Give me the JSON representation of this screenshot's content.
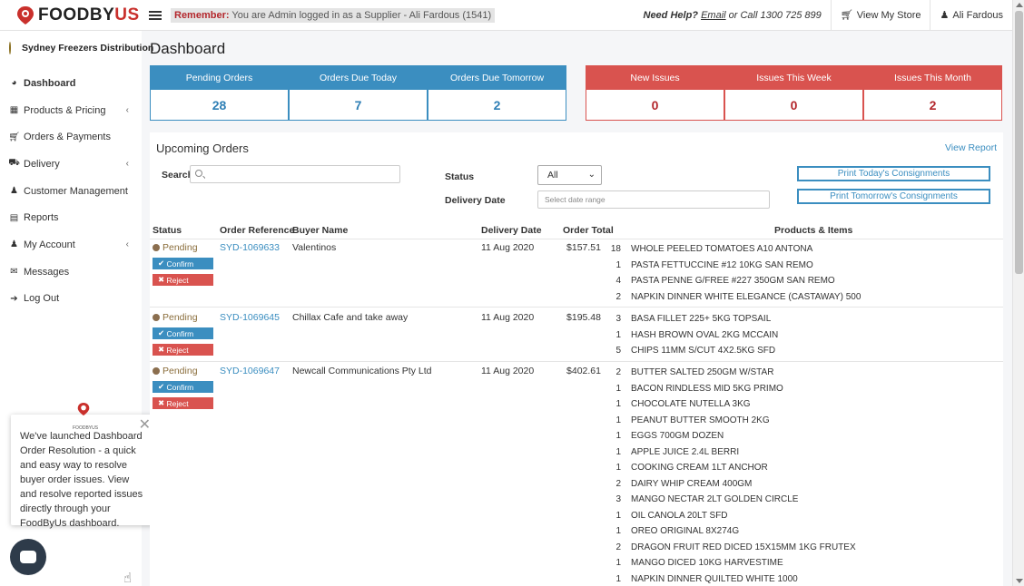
{
  "brand": {
    "name_main": "FOODBY",
    "name_accent": "US",
    "small": "FOODBYUS"
  },
  "header": {
    "remember_label": "Remember:",
    "remember_text": "You are Admin logged in as a Supplier - Ali Fardous (1541)",
    "help_prefix": "Need Help?",
    "help_email": "Email",
    "help_suffix": "or Call 1300 725 899",
    "view_store": "View My Store",
    "user": "Ali Fardous"
  },
  "sidebar": {
    "store_name": "Sydney Freezers Distribution",
    "items": [
      {
        "label": "Dashboard",
        "icon": "dashboard-icon"
      },
      {
        "label": "Products & Pricing",
        "icon": "gift-icon"
      },
      {
        "label": "Orders & Payments",
        "icon": "cart-icon"
      },
      {
        "label": "Delivery",
        "icon": "truck-icon"
      },
      {
        "label": "Customer Management",
        "icon": "users-icon"
      },
      {
        "label": "Reports",
        "icon": "bar-chart-icon"
      },
      {
        "label": "My Account",
        "icon": "user-icon"
      },
      {
        "label": "Messages",
        "icon": "envelope-icon"
      },
      {
        "label": "Log Out",
        "icon": "sign-out-icon"
      }
    ]
  },
  "promo": {
    "text": "We've launched Dashboard Order Resolution - a quick and easy way to resolve buyer order issues. View and resolve reported issues directly through your FoodByUs dashboard."
  },
  "page": {
    "title": "Dashboard"
  },
  "stats_blue": [
    {
      "label": "Pending Orders",
      "value": "28"
    },
    {
      "label": "Orders Due Today",
      "value": "7"
    },
    {
      "label": "Orders Due Tomorrow",
      "value": "2"
    }
  ],
  "stats_red": [
    {
      "label": "New Issues",
      "value": "0"
    },
    {
      "label": "Issues This Week",
      "value": "0"
    },
    {
      "label": "Issues This Month",
      "value": "2"
    }
  ],
  "upcoming": {
    "title": "Upcoming Orders",
    "view_report": "View Report",
    "search_label": "Search",
    "status_label": "Status",
    "status_value": "All",
    "delivery_date_label": "Delivery Date",
    "date_placeholder": "Select date range",
    "print_today": "Print Today's Consignments",
    "print_tomorrow": "Print Tomorrow's Consignments",
    "columns": [
      "Status",
      "Order Reference",
      "Buyer Name",
      "Delivery Date",
      "Order Total",
      "Products & Items"
    ],
    "confirm_label": "Confirm",
    "reject_label": "Reject",
    "orders": [
      {
        "status": "Pending",
        "ref": "SYD-1069633",
        "buyer": "Valentinos",
        "date": "11 Aug 2020",
        "total": "$157.51",
        "items": [
          {
            "qty": "18",
            "name": "WHOLE PEELED TOMATOES A10 ANTONA"
          },
          {
            "qty": "1",
            "name": "PASTA FETTUCCINE #12 10KG SAN REMO"
          },
          {
            "qty": "4",
            "name": "PASTA PENNE G/FREE #227 350GM SAN REMO"
          },
          {
            "qty": "2",
            "name": "NAPKIN DINNER WHITE ELEGANCE (CASTAWAY) 500"
          }
        ]
      },
      {
        "status": "Pending",
        "ref": "SYD-1069645",
        "buyer": "Chillax Cafe and take away",
        "date": "11 Aug 2020",
        "total": "$195.48",
        "items": [
          {
            "qty": "3",
            "name": "BASA FILLET 225+ 5KG TOPSAIL"
          },
          {
            "qty": "1",
            "name": "HASH BROWN OVAL 2KG MCCAIN"
          },
          {
            "qty": "5",
            "name": "CHIPS 11MM S/CUT 4X2.5KG SFD"
          }
        ]
      },
      {
        "status": "Pending",
        "ref": "SYD-1069647",
        "buyer": "Newcall Communications Pty Ltd",
        "date": "11 Aug 2020",
        "total": "$402.61",
        "items": [
          {
            "qty": "2",
            "name": "BUTTER SALTED 250GM W/STAR"
          },
          {
            "qty": "1",
            "name": "BACON RINDLESS MID 5KG PRIMO"
          },
          {
            "qty": "1",
            "name": "CHOCOLATE NUTELLA 3KG"
          },
          {
            "qty": "1",
            "name": "PEANUT BUTTER SMOOTH 2KG"
          },
          {
            "qty": "1",
            "name": "EGGS 700GM DOZEN"
          },
          {
            "qty": "1",
            "name": "APPLE JUICE 2.4L BERRI"
          },
          {
            "qty": "1",
            "name": "COOKING CREAM 1LT ANCHOR"
          },
          {
            "qty": "2",
            "name": "DAIRY WHIP CREAM 400GM"
          },
          {
            "qty": "3",
            "name": "MANGO NECTAR 2LT GOLDEN CIRCLE"
          },
          {
            "qty": "1",
            "name": "OIL CANOLA 20LT SFD"
          },
          {
            "qty": "1",
            "name": "OREO ORIGINAL 8X274G"
          },
          {
            "qty": "2",
            "name": "DRAGON FRUIT RED DICED 15X15MM 1KG FRUTEX"
          },
          {
            "qty": "1",
            "name": "MANGO DICED 10KG HARVESTIME"
          },
          {
            "qty": "1",
            "name": "NAPKIN DINNER QUILTED WHITE 1000"
          }
        ]
      }
    ]
  },
  "colors": {
    "primary_blue": "#3b8ec0",
    "alert_red": "#d9534f",
    "brand_red": "#c9302c"
  }
}
